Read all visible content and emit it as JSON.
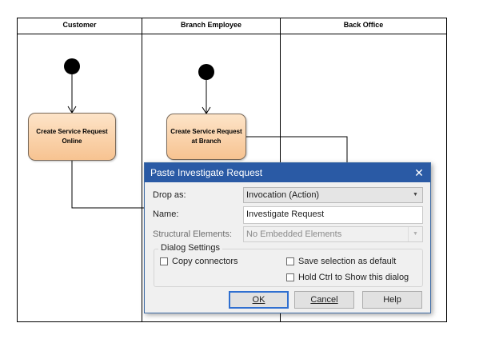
{
  "lanes": [
    {
      "label": "Customer"
    },
    {
      "label": "Branch Employee"
    },
    {
      "label": "Back Office"
    }
  ],
  "actions": [
    {
      "label": "Create Service Request Online"
    },
    {
      "label": "Create Service Request at  Branch"
    }
  ],
  "dialog": {
    "title": "Paste Investigate Request",
    "close_glyph": "✕",
    "drop_as_label": "Drop as:",
    "drop_as_value": "Invocation (Action)",
    "name_label": "Name:",
    "name_value": "Investigate Request",
    "structural_label": "Structural Elements:",
    "structural_value": "No Embedded Elements",
    "settings_label": "Dialog Settings",
    "copy_connectors": "Copy connectors",
    "save_selection": "Save selection as default",
    "hold_ctrl": "Hold Ctrl to Show this dialog",
    "ok_label": "OK",
    "cancel_label": "Cancel",
    "help_label": "Help"
  },
  "colors": {
    "title_bar": "#2a5aa5",
    "action_fill": "#f7c391",
    "lane_line": "#000000"
  }
}
